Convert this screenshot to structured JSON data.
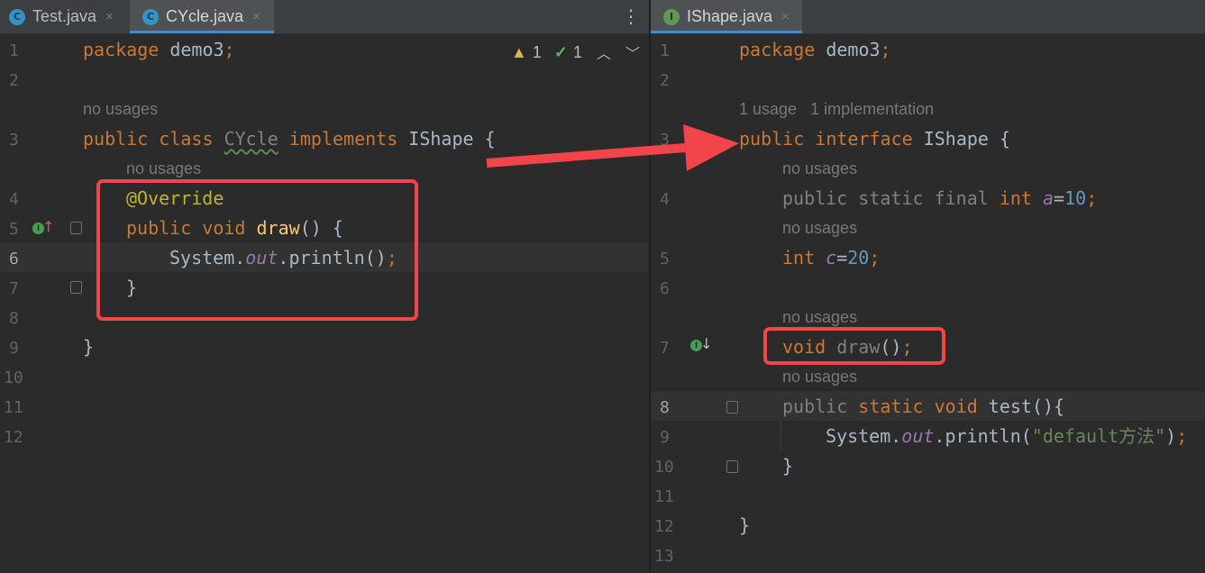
{
  "left": {
    "tabs": [
      {
        "icon": "C",
        "name": "Test.java",
        "close": "×"
      },
      {
        "icon": "C",
        "name": "CYcle.java",
        "close": "×"
      }
    ],
    "menu": "⋮",
    "inspect": {
      "warnings": "1",
      "weak": "1"
    },
    "line_numbers": [
      "1",
      "2",
      "3",
      "4",
      "5",
      "6",
      "7",
      "8",
      "9",
      "10",
      "11",
      "12"
    ],
    "hints": [
      "no usages",
      "no usages"
    ],
    "code": {
      "l1_kw": "package",
      "l1_rest": " demo3",
      "l1_semi": ";",
      "l3_kw1": "public",
      "l3_kw2": "class",
      "l3_cls": "CYcle",
      "l3_kw3": "implements",
      "l3_rest": " IShape {",
      "l4_ann": "@Override",
      "l5_kw1": "public",
      "l5_kw2": "void",
      "l5_fn": "draw",
      "l5_rest": "() {",
      "l6_a": "System.",
      "l6_st": "out",
      "l6_b": ".println()",
      "l6_semi": ";",
      "l7": "}",
      "l9": "}"
    }
  },
  "right": {
    "tabs": [
      {
        "icon": "I",
        "name": "IShape.java",
        "close": "×"
      }
    ],
    "line_numbers": [
      "1",
      "2",
      "3",
      "4",
      "5",
      "6",
      "7",
      "8",
      "9",
      "10",
      "11",
      "12",
      "13"
    ],
    "hints": {
      "usage": "1 usage",
      "impl": "1 implementation",
      "h1": "no usages",
      "h2": "no usages",
      "h3": "no usages",
      "h4": "no usages"
    },
    "code": {
      "l1_kw": "package",
      "l1_rest": " demo3",
      "l1_semi": ";",
      "l3_kw1": "public",
      "l3_kw2": "interface",
      "l3_rest": " IShape {",
      "l4_a": "public static final ",
      "l4_kw": "int",
      "l4_var": "a",
      "l4_eq": "=",
      "l4_num": "10",
      "l4_semi": ";",
      "l5_kw": "int",
      "l5_var": "c",
      "l5_eq": "=",
      "l5_num": "20",
      "l5_semi": ";",
      "l7_kw": "void",
      "l7_fn": "draw",
      "l7_rest": "()",
      "l7_semi": ";",
      "l8_kw0": "public",
      "l8_kw1": "static",
      "l8_kw2": "void",
      "l8_rest": " test(){",
      "l9_a": "System.",
      "l9_st": "out",
      "l9_b": ".println(",
      "l9_str": "\"default方法\"",
      "l9_c": ")",
      "l9_semi": ";",
      "l10": "}",
      "l12": "}"
    }
  },
  "colors": {
    "keyword": "#cc7832",
    "annotation": "#bbb529",
    "method": "#ffc66d",
    "static_field": "#9876aa",
    "number": "#6897bb",
    "string": "#6a8759",
    "text": "#a9b7c6",
    "highlight_box": "#f2444b"
  }
}
